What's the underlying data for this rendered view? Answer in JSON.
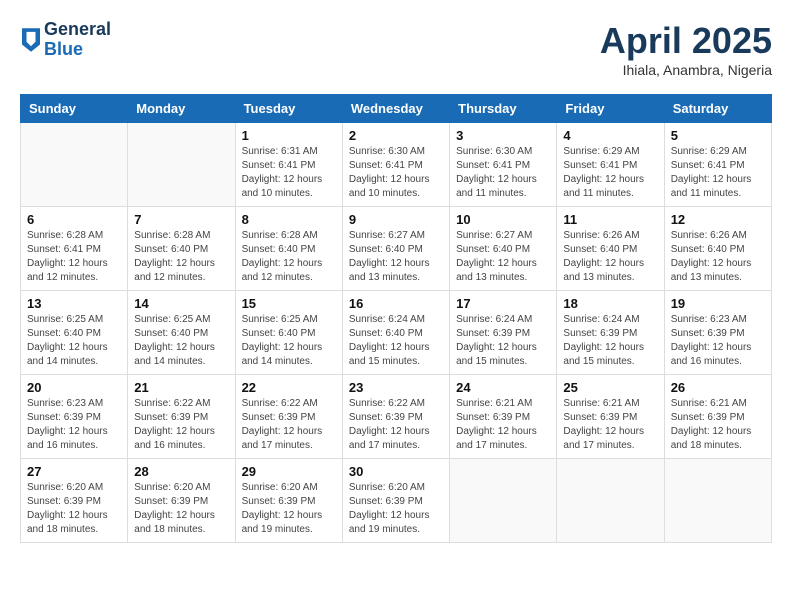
{
  "header": {
    "logo_general": "General",
    "logo_blue": "Blue",
    "month": "April 2025",
    "location": "Ihiala, Anambra, Nigeria"
  },
  "days_of_week": [
    "Sunday",
    "Monday",
    "Tuesday",
    "Wednesday",
    "Thursday",
    "Friday",
    "Saturday"
  ],
  "weeks": [
    [
      {
        "day": "",
        "info": ""
      },
      {
        "day": "",
        "info": ""
      },
      {
        "day": "1",
        "info": "Sunrise: 6:31 AM\nSunset: 6:41 PM\nDaylight: 12 hours\nand 10 minutes."
      },
      {
        "day": "2",
        "info": "Sunrise: 6:30 AM\nSunset: 6:41 PM\nDaylight: 12 hours\nand 10 minutes."
      },
      {
        "day": "3",
        "info": "Sunrise: 6:30 AM\nSunset: 6:41 PM\nDaylight: 12 hours\nand 11 minutes."
      },
      {
        "day": "4",
        "info": "Sunrise: 6:29 AM\nSunset: 6:41 PM\nDaylight: 12 hours\nand 11 minutes."
      },
      {
        "day": "5",
        "info": "Sunrise: 6:29 AM\nSunset: 6:41 PM\nDaylight: 12 hours\nand 11 minutes."
      }
    ],
    [
      {
        "day": "6",
        "info": "Sunrise: 6:28 AM\nSunset: 6:41 PM\nDaylight: 12 hours\nand 12 minutes."
      },
      {
        "day": "7",
        "info": "Sunrise: 6:28 AM\nSunset: 6:40 PM\nDaylight: 12 hours\nand 12 minutes."
      },
      {
        "day": "8",
        "info": "Sunrise: 6:28 AM\nSunset: 6:40 PM\nDaylight: 12 hours\nand 12 minutes."
      },
      {
        "day": "9",
        "info": "Sunrise: 6:27 AM\nSunset: 6:40 PM\nDaylight: 12 hours\nand 13 minutes."
      },
      {
        "day": "10",
        "info": "Sunrise: 6:27 AM\nSunset: 6:40 PM\nDaylight: 12 hours\nand 13 minutes."
      },
      {
        "day": "11",
        "info": "Sunrise: 6:26 AM\nSunset: 6:40 PM\nDaylight: 12 hours\nand 13 minutes."
      },
      {
        "day": "12",
        "info": "Sunrise: 6:26 AM\nSunset: 6:40 PM\nDaylight: 12 hours\nand 13 minutes."
      }
    ],
    [
      {
        "day": "13",
        "info": "Sunrise: 6:25 AM\nSunset: 6:40 PM\nDaylight: 12 hours\nand 14 minutes."
      },
      {
        "day": "14",
        "info": "Sunrise: 6:25 AM\nSunset: 6:40 PM\nDaylight: 12 hours\nand 14 minutes."
      },
      {
        "day": "15",
        "info": "Sunrise: 6:25 AM\nSunset: 6:40 PM\nDaylight: 12 hours\nand 14 minutes."
      },
      {
        "day": "16",
        "info": "Sunrise: 6:24 AM\nSunset: 6:40 PM\nDaylight: 12 hours\nand 15 minutes."
      },
      {
        "day": "17",
        "info": "Sunrise: 6:24 AM\nSunset: 6:39 PM\nDaylight: 12 hours\nand 15 minutes."
      },
      {
        "day": "18",
        "info": "Sunrise: 6:24 AM\nSunset: 6:39 PM\nDaylight: 12 hours\nand 15 minutes."
      },
      {
        "day": "19",
        "info": "Sunrise: 6:23 AM\nSunset: 6:39 PM\nDaylight: 12 hours\nand 16 minutes."
      }
    ],
    [
      {
        "day": "20",
        "info": "Sunrise: 6:23 AM\nSunset: 6:39 PM\nDaylight: 12 hours\nand 16 minutes."
      },
      {
        "day": "21",
        "info": "Sunrise: 6:22 AM\nSunset: 6:39 PM\nDaylight: 12 hours\nand 16 minutes."
      },
      {
        "day": "22",
        "info": "Sunrise: 6:22 AM\nSunset: 6:39 PM\nDaylight: 12 hours\nand 17 minutes."
      },
      {
        "day": "23",
        "info": "Sunrise: 6:22 AM\nSunset: 6:39 PM\nDaylight: 12 hours\nand 17 minutes."
      },
      {
        "day": "24",
        "info": "Sunrise: 6:21 AM\nSunset: 6:39 PM\nDaylight: 12 hours\nand 17 minutes."
      },
      {
        "day": "25",
        "info": "Sunrise: 6:21 AM\nSunset: 6:39 PM\nDaylight: 12 hours\nand 17 minutes."
      },
      {
        "day": "26",
        "info": "Sunrise: 6:21 AM\nSunset: 6:39 PM\nDaylight: 12 hours\nand 18 minutes."
      }
    ],
    [
      {
        "day": "27",
        "info": "Sunrise: 6:20 AM\nSunset: 6:39 PM\nDaylight: 12 hours\nand 18 minutes."
      },
      {
        "day": "28",
        "info": "Sunrise: 6:20 AM\nSunset: 6:39 PM\nDaylight: 12 hours\nand 18 minutes."
      },
      {
        "day": "29",
        "info": "Sunrise: 6:20 AM\nSunset: 6:39 PM\nDaylight: 12 hours\nand 19 minutes."
      },
      {
        "day": "30",
        "info": "Sunrise: 6:20 AM\nSunset: 6:39 PM\nDaylight: 12 hours\nand 19 minutes."
      },
      {
        "day": "",
        "info": ""
      },
      {
        "day": "",
        "info": ""
      },
      {
        "day": "",
        "info": ""
      }
    ]
  ]
}
